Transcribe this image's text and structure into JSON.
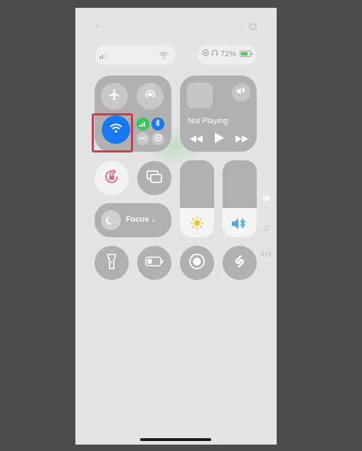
{
  "top_bar": {
    "add_icon": "plus-icon",
    "power_icon": "power-icon"
  },
  "status": {
    "battery_percent": "72%",
    "battery_level": 0.72,
    "icons": [
      "cellular-signal-icon",
      "wifi-icon",
      "orientation-lock-icon",
      "headphones-icon",
      "battery-icon"
    ]
  },
  "connectivity": {
    "airplane_icon": "airplane-icon",
    "airdrop_icon": "airdrop-icon",
    "wifi_icon": "wifi-icon",
    "cellular_icon": "cellular-data-icon",
    "bluetooth_icon": "bluetooth-icon",
    "hotspot_icon": "personal-hotspot-icon",
    "vpn_icon": "vpn-icon",
    "wifi_on_color": "#1877f2",
    "highlight_color": "#d6374d"
  },
  "media": {
    "now_playing": "Not Playing",
    "airplay_icon": "airplay-audio-icon"
  },
  "focus": {
    "label": "Focus",
    "chevron": "⌃"
  },
  "sliders": {
    "brightness_level": 0.38,
    "volume_level": 0.38,
    "brightness_icon": "sun-icon",
    "volume_icon": "speaker-bluetooth-icon"
  },
  "bottom_row": [
    "flashlight-icon",
    "low-power-icon",
    "screen-record-icon",
    "shazam-icon"
  ]
}
